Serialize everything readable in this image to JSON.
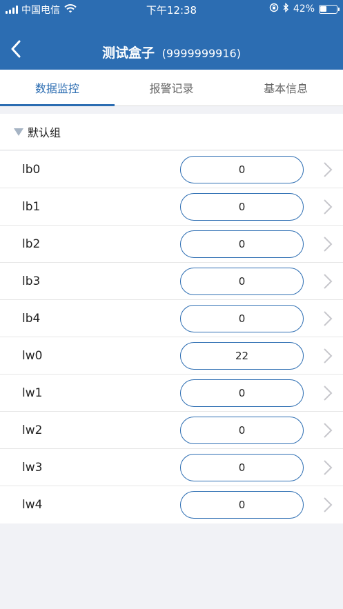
{
  "status_bar": {
    "carrier": "中国电信",
    "time": "下午12:38",
    "battery_text": "42%",
    "battery_level": 0.42,
    "icons": [
      "signal-icon",
      "wifi-icon",
      "orientation-lock-icon",
      "bluetooth-icon",
      "battery-icon"
    ]
  },
  "nav": {
    "back_icon": "chevron-left-icon",
    "title": "测试盒子",
    "subtitle": "(9999999916)"
  },
  "tabs": [
    {
      "label": "数据监控",
      "active": true
    },
    {
      "label": "报警记录",
      "active": false
    },
    {
      "label": "基本信息",
      "active": false
    }
  ],
  "group": {
    "label": "默认组",
    "icon": "triangle-down-icon"
  },
  "rows": [
    {
      "label": "lb0",
      "value": "0"
    },
    {
      "label": "lb1",
      "value": "0"
    },
    {
      "label": "lb2",
      "value": "0"
    },
    {
      "label": "lb3",
      "value": "0"
    },
    {
      "label": "lb4",
      "value": "0"
    },
    {
      "label": "lw0",
      "value": "22"
    },
    {
      "label": "lw1",
      "value": "0"
    },
    {
      "label": "lw2",
      "value": "0"
    },
    {
      "label": "lw3",
      "value": "0"
    },
    {
      "label": "lw4",
      "value": "0"
    }
  ],
  "colors": {
    "primary": "#2c6db2",
    "background": "#f1f2f6",
    "chevron": "#c7c7cc",
    "triangle": "#a6b4c4"
  }
}
